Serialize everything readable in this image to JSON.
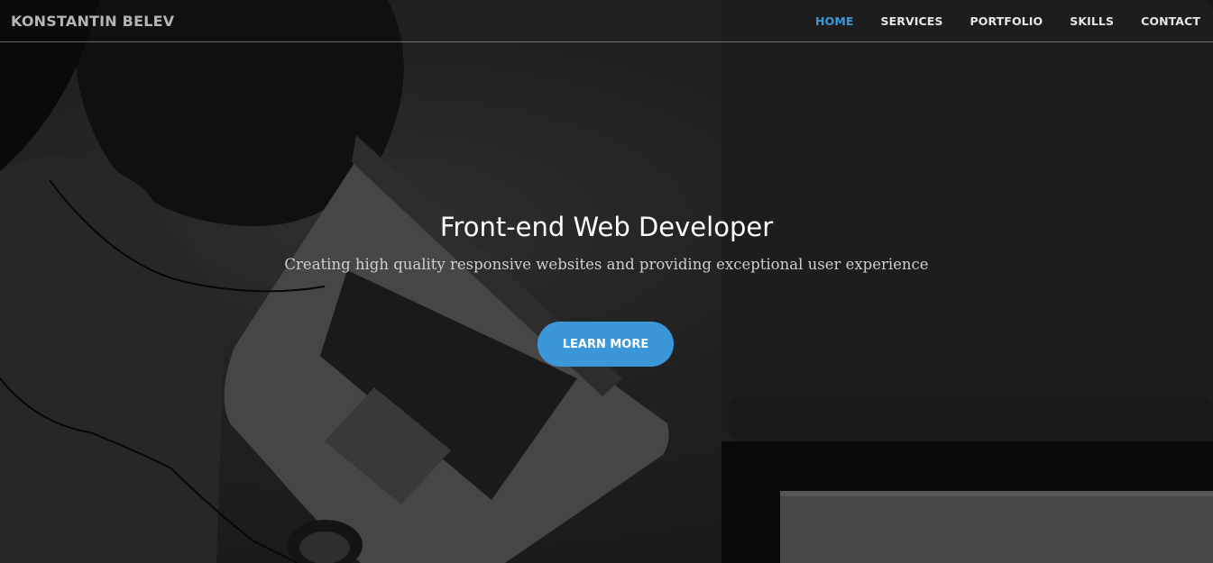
{
  "brand": {
    "name": "KONSTANTIN BELEV"
  },
  "nav": {
    "items": [
      {
        "label": "HOME",
        "active": true
      },
      {
        "label": "SERVICES",
        "active": false
      },
      {
        "label": "PORTFOLIO",
        "active": false
      },
      {
        "label": "SKILLS",
        "active": false
      },
      {
        "label": "CONTACT",
        "active": false
      }
    ]
  },
  "hero": {
    "title": "Front-end Web Developer",
    "subtitle": "Creating high quality responsive websites and providing exceptional user experience",
    "cta_label": "LEARN MORE"
  },
  "colors": {
    "accent": "#3b97d8",
    "nav_text": "#e6e6e6",
    "brand_text": "#b5b5b5",
    "hero_title": "#ffffff",
    "hero_subtitle": "#cfcfcf"
  },
  "background": {
    "image": "laptop-headphones-photo"
  }
}
